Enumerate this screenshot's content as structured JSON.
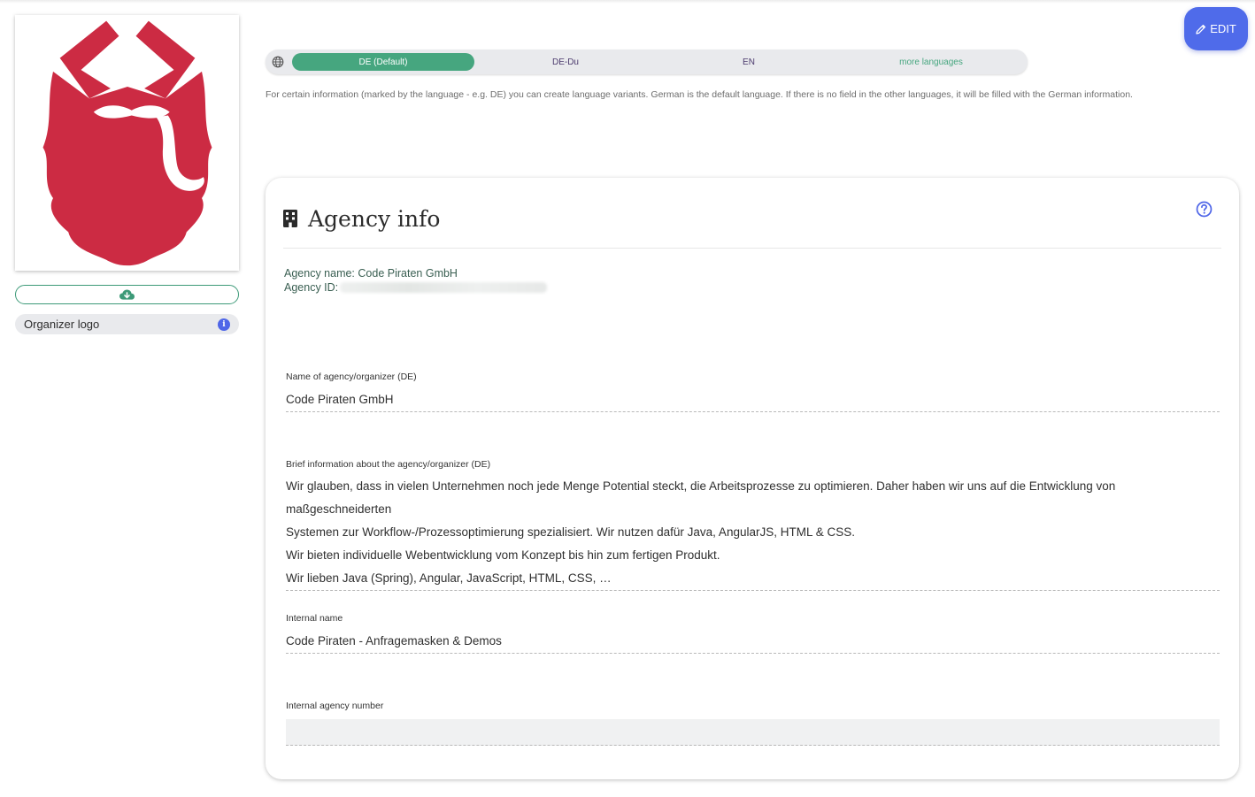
{
  "sidebar": {
    "logo_label": "Organizer logo"
  },
  "toolbar": {
    "edit_label": "EDIT"
  },
  "languages": {
    "tabs": [
      "DE (Default)",
      "DE-Du",
      "EN",
      "more languages"
    ],
    "active": "DE (Default)",
    "note": "For certain information (marked by the language - e.g. DE) you can create language variants. German is the default language. If there is no field in the other languages, it will be filled with the German information."
  },
  "card": {
    "title": "Agency info",
    "agency_name_label": "Agency name:",
    "agency_name": "Code Piraten GmbH",
    "agency_id_label": "Agency ID:"
  },
  "fields": {
    "name_label": "Name of agency/organizer (DE)",
    "name_value": "Code Piraten GmbH",
    "brief_label": "Brief information about the agency/organizer (DE)",
    "brief_lines": [
      "Wir glauben, dass in vielen Unternehmen noch jede Menge Potential steckt, die Arbeitsprozesse zu optimieren. Daher haben wir uns auf die Entwicklung von maßgeschneiderten",
      "Systemen zur Workflow-/Prozessoptimierung spezialisiert. Wir nutzen dafür Java, AngularJS, HTML & CSS.",
      "Wir bieten individuelle Webentwicklung vom Konzept bis hin zum fertigen Produkt.",
      "Wir lieben Java (Spring), Angular, JavaScript, HTML, CSS, …"
    ],
    "internal_name_label": "Internal name",
    "internal_name_value": "Code Piraten - Anfragemasken & Demos",
    "internal_number_label": "Internal agency number",
    "internal_number_value": ""
  },
  "colors": {
    "accent": "#46a67f",
    "primary": "#4f6bea",
    "logo": "#cc2b43"
  },
  "icons": {
    "logo": "pirate-beard-logo",
    "upload": "cloud-download-icon",
    "info": "info-icon",
    "edit": "pencil-icon",
    "globe": "globe-icon",
    "building": "building-icon",
    "help": "question-circle-icon"
  }
}
